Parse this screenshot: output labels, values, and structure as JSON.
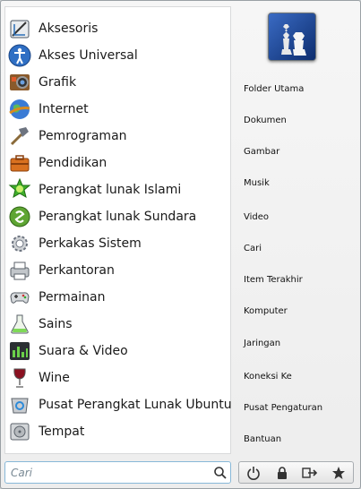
{
  "categories": [
    {
      "label": "Aksesoris",
      "icon": "accessories-icon"
    },
    {
      "label": "Akses Universal",
      "icon": "universal-access-icon"
    },
    {
      "label": "Grafik",
      "icon": "graphics-icon"
    },
    {
      "label": "Internet",
      "icon": "internet-globe-icon"
    },
    {
      "label": "Pemrograman",
      "icon": "programming-hammer-icon"
    },
    {
      "label": "Pendidikan",
      "icon": "education-briefcase-icon"
    },
    {
      "label": "Perangkat lunak Islami",
      "icon": "islamic-software-icon"
    },
    {
      "label": "Perangkat lunak Sundara",
      "icon": "sundara-software-icon"
    },
    {
      "label": "Perkakas Sistem",
      "icon": "system-tools-gear-icon"
    },
    {
      "label": "Perkantoran",
      "icon": "office-printer-icon"
    },
    {
      "label": "Permainan",
      "icon": "games-gamepad-icon"
    },
    {
      "label": "Sains",
      "icon": "science-flask-icon"
    },
    {
      "label": "Suara & Video",
      "icon": "sound-video-icon"
    },
    {
      "label": "Wine",
      "icon": "wine-glass-icon"
    },
    {
      "label": "Pusat Perangkat Lunak Ubuntu",
      "icon": "software-center-icon"
    },
    {
      "label": "Tempat",
      "icon": "places-drive-icon"
    }
  ],
  "places": [
    {
      "label": "Folder Utama"
    },
    {
      "label": "Dokumen"
    },
    {
      "label": "Gambar"
    },
    {
      "label": "Musik"
    },
    {
      "label": "Video"
    },
    {
      "label": "Cari"
    },
    {
      "label": "Item Terakhir"
    },
    {
      "label": "Komputer"
    },
    {
      "label": "Jaringan"
    },
    {
      "label": "Koneksi Ke"
    },
    {
      "label": "Pusat Pengaturan"
    },
    {
      "label": "Bantuan"
    }
  ],
  "search": {
    "placeholder": "Cari",
    "value": ""
  },
  "actions": [
    {
      "icon": "power-icon"
    },
    {
      "icon": "lock-icon"
    },
    {
      "icon": "logout-icon"
    },
    {
      "icon": "favorites-star-icon"
    }
  ],
  "colors": {
    "search_border": "#88b8d8",
    "menu_background": "#f0f0f0"
  }
}
